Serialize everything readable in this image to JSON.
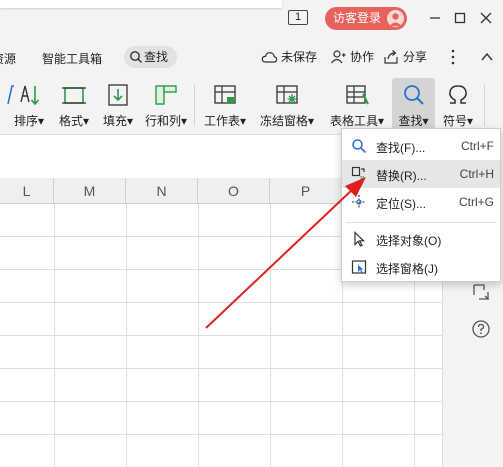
{
  "titlebar": {
    "counter_badge": "1",
    "login_button": "访客登录"
  },
  "menu": {
    "partial_tab": "资源",
    "smart_tools": "智能工具箱",
    "search_tab": "查找",
    "unsaved": "未保存",
    "collaborate": "协作",
    "share": "分享"
  },
  "ribbon": {
    "sort": "排序",
    "format": "格式",
    "fill": "填充",
    "row_col": "行和列",
    "worksheet": "工作表",
    "freeze": "冻结窗格",
    "table_tools": "表格工具",
    "find": "查找",
    "symbol": "符号"
  },
  "sheet": {
    "columns": [
      "L",
      "M",
      "N",
      "O",
      "P"
    ]
  },
  "dropdown": {
    "items": [
      {
        "label": "查找(F)...",
        "shortcut": "Ctrl+F"
      },
      {
        "label": "替换(R)...",
        "shortcut": "Ctrl+H"
      },
      {
        "label": "定位(S)...",
        "shortcut": "Ctrl+G"
      },
      {
        "label": "选择对象(O)",
        "shortcut": ""
      },
      {
        "label": "选择窗格(J)",
        "shortcut": ""
      }
    ]
  },
  "colors": {
    "accent_blue": "#2b6fd6",
    "login_red": "#e6625b",
    "arrow_red": "#e02020"
  }
}
